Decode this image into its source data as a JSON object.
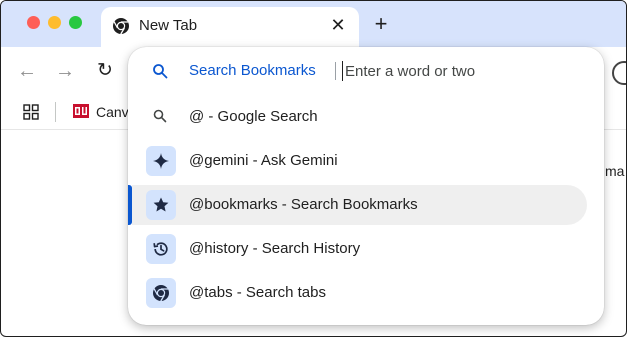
{
  "window": {
    "tab": {
      "title": "New Tab",
      "close_glyph": "✕"
    },
    "new_tab_glyph": "+"
  },
  "toolbar": {
    "back_glyph": "←",
    "forward_glyph": "→",
    "reload_glyph": "↻"
  },
  "bookmarks_bar": {
    "items": [
      {
        "label": "Canv",
        "icon": "canvas-logo-icon"
      }
    ]
  },
  "page": {
    "peek_text": "ma"
  },
  "omnibox": {
    "chip_label": "Search Bookmarks",
    "placeholder": "Enter a word or two",
    "suggestions": [
      {
        "label": "@ - Google Search",
        "icon": "search-icon"
      },
      {
        "label": "@gemini - Ask Gemini",
        "icon": "sparkle-icon"
      },
      {
        "label": "@bookmarks - Search Bookmarks",
        "icon": "star-icon",
        "selected": true
      },
      {
        "label": "@history - Search History",
        "icon": "history-icon"
      },
      {
        "label": "@tabs - Search tabs",
        "icon": "chrome-icon"
      }
    ]
  },
  "colors": {
    "accent": "#0b57d0",
    "tabstrip": "#d7e3fc",
    "icon_box": "#d3e3fd",
    "selected_row": "#efefef"
  }
}
